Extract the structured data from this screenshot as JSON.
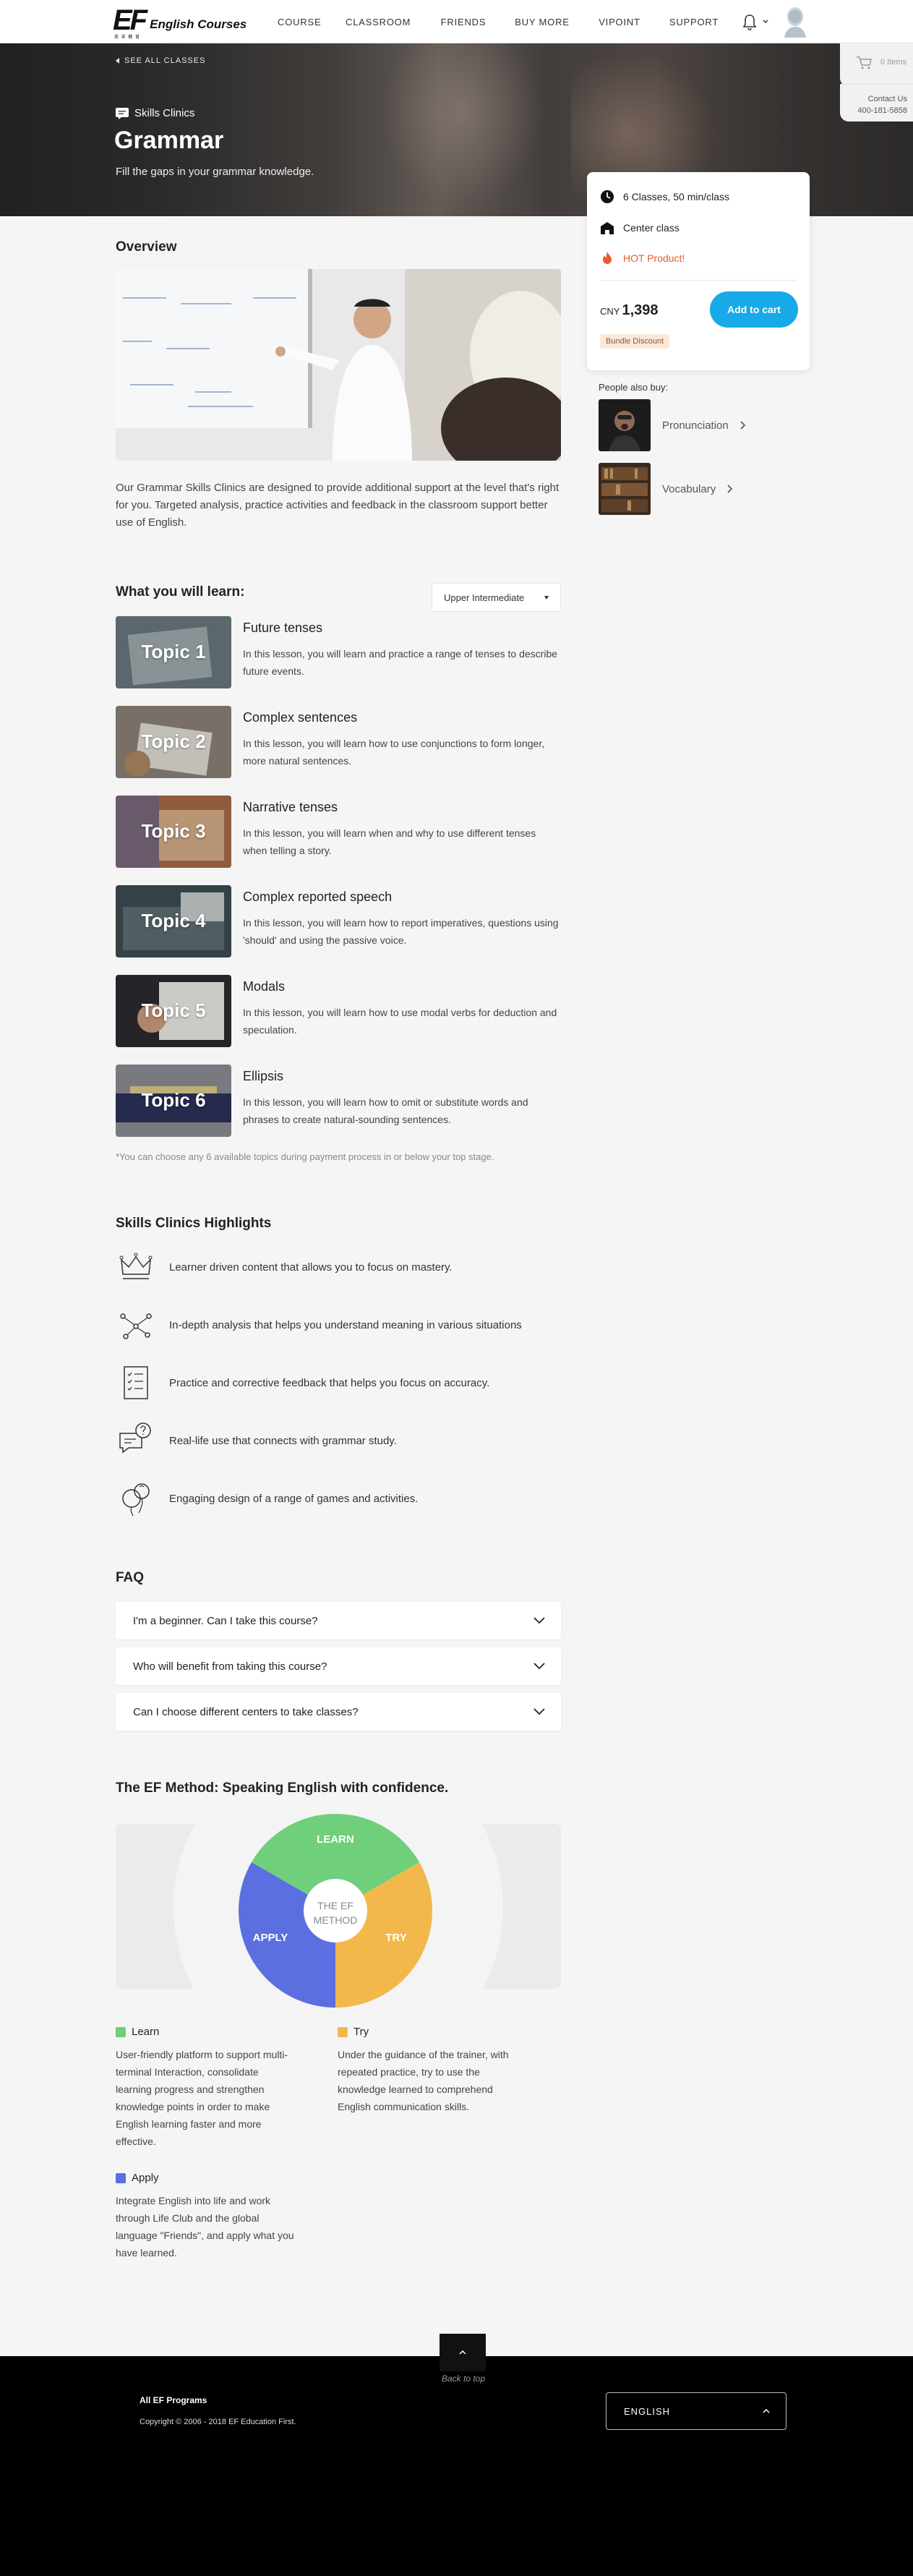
{
  "nav": {
    "logo_text": "EF",
    "logo_sub": "英 孚 教 育",
    "logo_title": "English Courses",
    "items": [
      {
        "label": "COURSE",
        "name": "nav-course"
      },
      {
        "label": "CLASSROOM",
        "name": "nav-classroom"
      },
      {
        "label": "FRIENDS",
        "name": "nav-friends"
      },
      {
        "label": "BUY MORE",
        "name": "nav-buy-more"
      },
      {
        "label": "VIPOINT",
        "name": "nav-vipoint"
      },
      {
        "label": "SUPPORT",
        "name": "nav-support"
      }
    ]
  },
  "side_tabs": {
    "cart_label": "0 Items",
    "contact_label": "Contact Us",
    "contact_phone": "400-181-5858"
  },
  "hero": {
    "back_label": "SEE ALL CLASSES",
    "category": "Skills Clinics",
    "title": "Grammar",
    "subtitle": "Fill the gaps in your grammar knowledge."
  },
  "price_card": {
    "classes": "6 Classes, 50 min/class",
    "location": "Center class",
    "hot": "HOT Product!",
    "currency": "CNY",
    "price": "1,398",
    "cta": "Add to cart",
    "badge": "Bundle Discount"
  },
  "also_buy": {
    "title": "People also buy:",
    "items": [
      {
        "label": "Pronunciation"
      },
      {
        "label": "Vocabulary"
      }
    ]
  },
  "overview": {
    "title": "Overview",
    "text": "Our Grammar Skills Clinics are designed to provide additional support at the level that's right for you. Targeted analysis, practice activities and feedback in the classroom support better use of English."
  },
  "learn": {
    "title": "What you will learn:",
    "level": "Upper Intermediate",
    "topics": [
      {
        "tag": "Topic 1",
        "title": "Future tenses",
        "desc": "In this lesson, you will learn and practice a range of tenses to describe future events."
      },
      {
        "tag": "Topic 2",
        "title": "Complex sentences",
        "desc": "In this lesson, you will learn how to use conjunctions to form longer, more natural sentences."
      },
      {
        "tag": "Topic 3",
        "title": "Narrative tenses",
        "desc": "In this lesson, you will learn when and why to use different tenses when telling a story."
      },
      {
        "tag": "Topic 4",
        "title": "Complex reported speech",
        "desc": "In this lesson, you will learn how to report imperatives, questions using 'should' and using the passive voice."
      },
      {
        "tag": "Topic 5",
        "title": "Modals",
        "desc": "In this lesson, you will learn how to use modal verbs for deduction and speculation."
      },
      {
        "tag": "Topic 6",
        "title": "Ellipsis",
        "desc": "In this lesson, you will learn how to omit or substitute words and phrases to create natural-sounding sentences."
      }
    ],
    "note": "*You can choose any 6 available topics during payment process in or below your top stage."
  },
  "highlights": {
    "title": "Skills Clinics Highlights",
    "items": [
      {
        "text": "Learner driven content that allows you to focus on mastery."
      },
      {
        "text": "In-depth analysis that helps you understand meaning in various situations"
      },
      {
        "text": "Practice and corrective feedback that helps you focus on accuracy."
      },
      {
        "text": "Real-life use that connects with grammar study."
      },
      {
        "text": "Engaging design of a range of games and activities."
      }
    ]
  },
  "faq": {
    "title": "FAQ",
    "items": [
      {
        "q": "I'm a beginner. Can I take this course?"
      },
      {
        "q": "Who will benefit from taking this course?"
      },
      {
        "q": "Can I choose different centers to take classes?"
      }
    ]
  },
  "method": {
    "title": "The EF Method: Speaking English with confidence.",
    "center_line1": "THE EF",
    "center_line2": "METHOD",
    "segments": [
      {
        "label": "LEARN",
        "color": "#6fcf7b"
      },
      {
        "label": "TRY",
        "color": "#f2b84b"
      },
      {
        "label": "APPLY",
        "color": "#5b6fe0"
      }
    ],
    "legend": [
      {
        "label": "Learn",
        "color": "#6fcf7b",
        "text": "User-friendly platform to support multi-terminal Interaction, consolidate learning progress and strengthen knowledge points in order to make English learning faster and more effective."
      },
      {
        "label": "Try",
        "color": "#f2b84b",
        "text": "Under the guidance of the trainer, with repeated practice, try to use the knowledge learned to comprehend English communication skills."
      },
      {
        "label": "Apply",
        "color": "#5b6fe0",
        "text": "Integrate English into life and work through Life Club and the global language \"Friends\", and apply what you have learned."
      }
    ]
  },
  "footer": {
    "back_to_top": "Back to top",
    "title": "All EF Programs",
    "copyright": "Copyright © 2006 - 2018 EF Education First.",
    "language": "ENGLISH"
  }
}
